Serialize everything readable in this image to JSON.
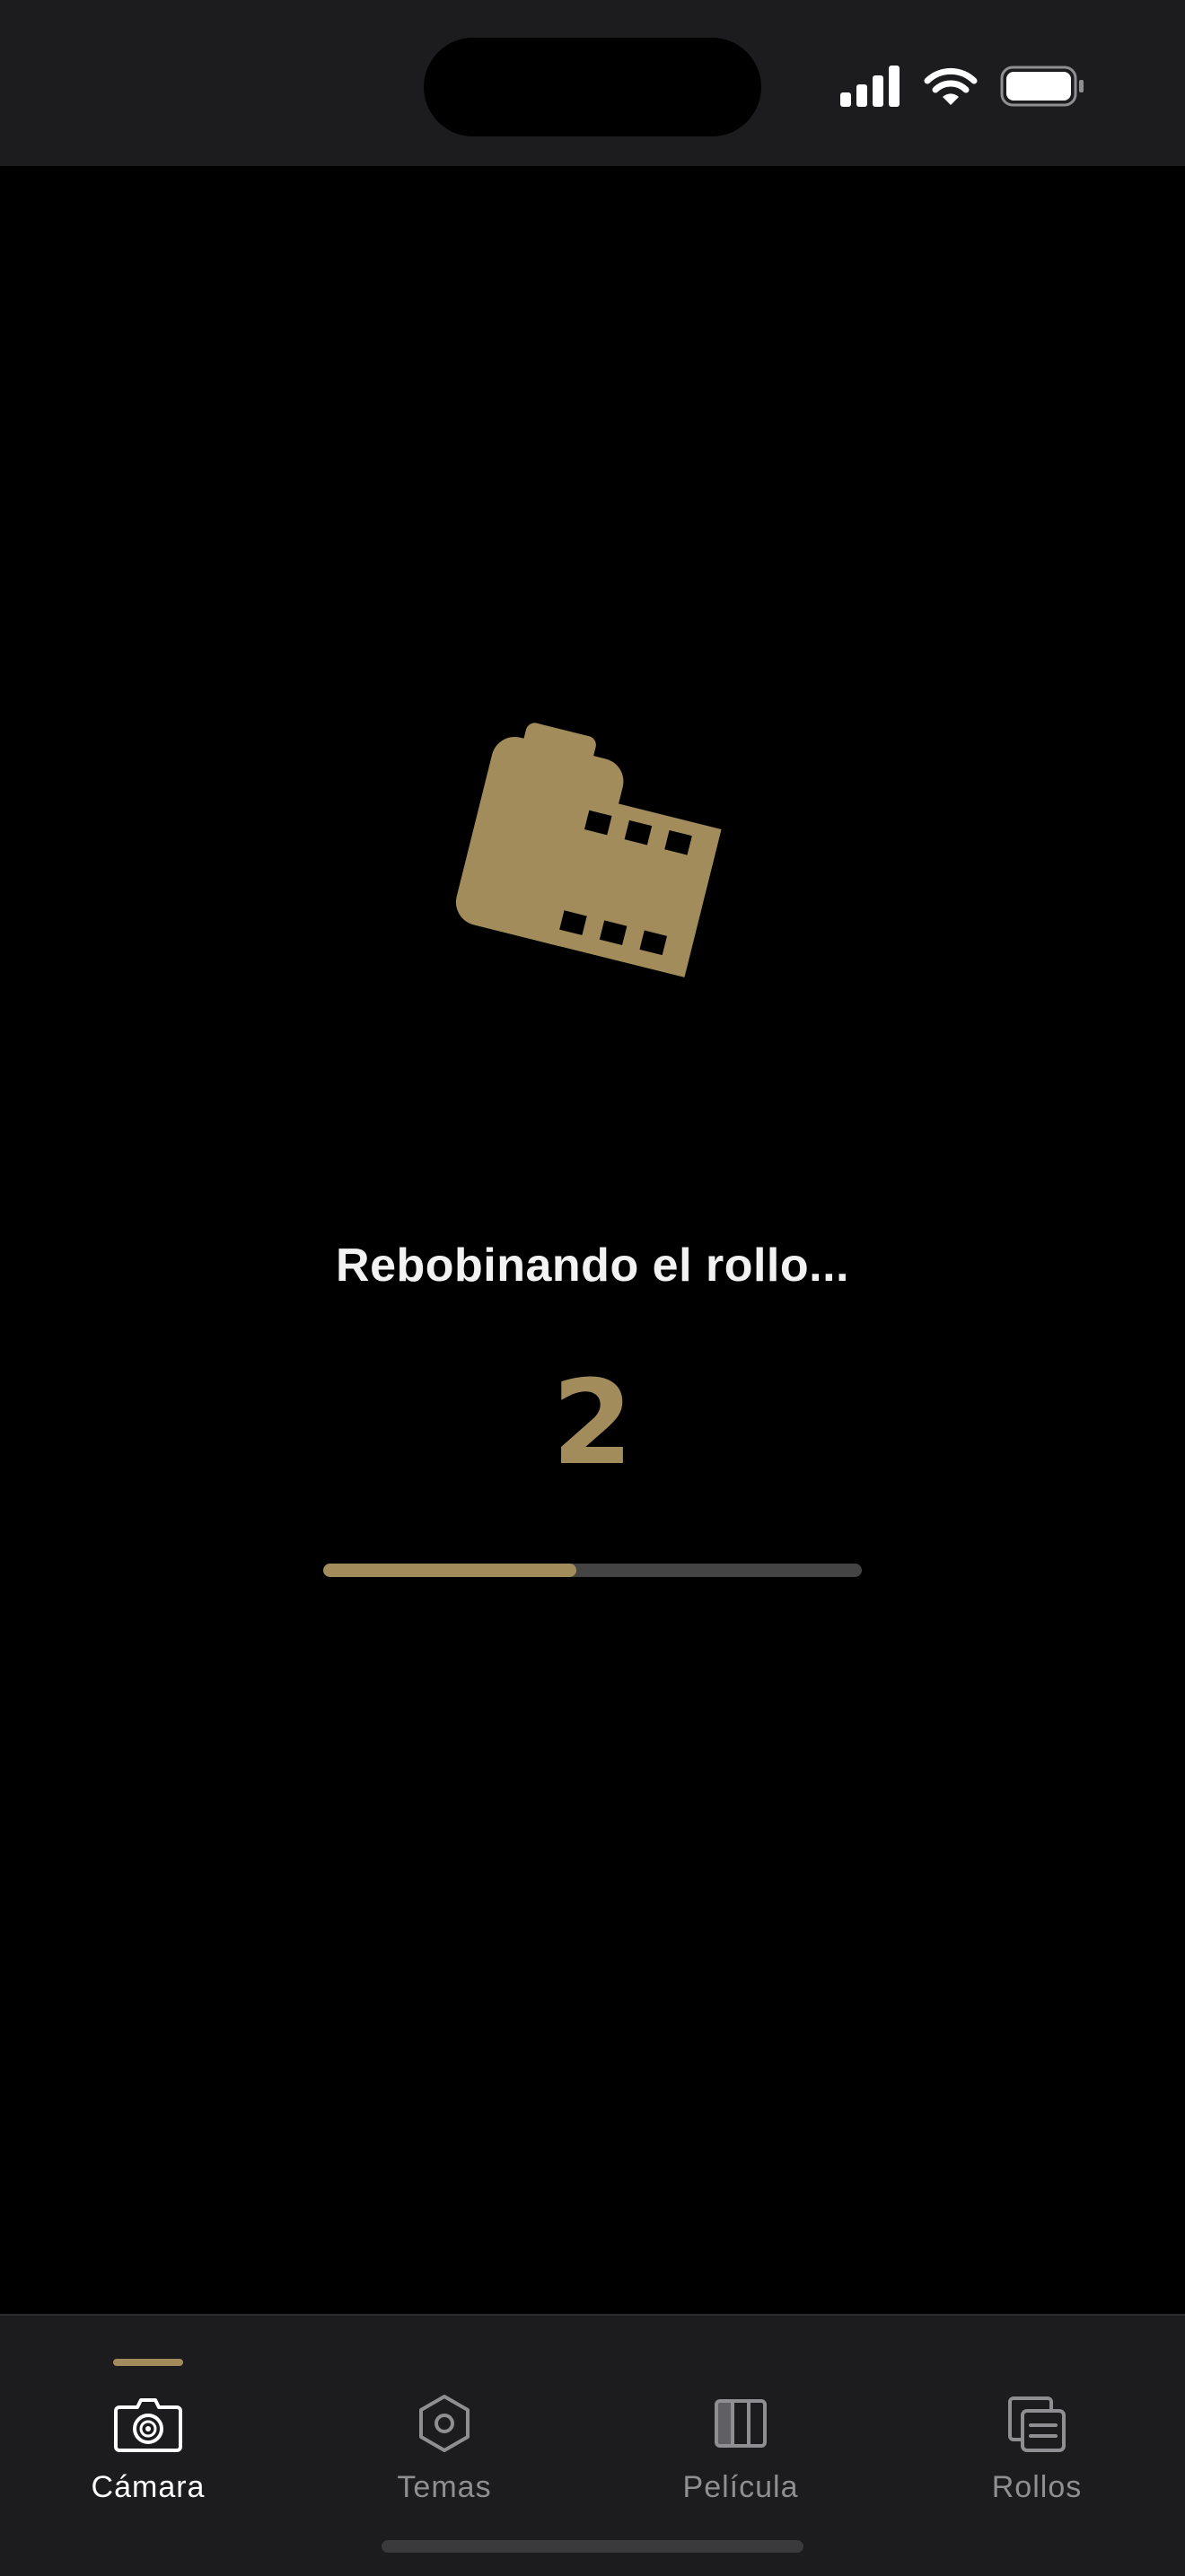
{
  "status_bar": {
    "icons": [
      "signal-icon",
      "wifi-icon",
      "battery-icon"
    ]
  },
  "main": {
    "icon": "film-canister-icon",
    "title": "Rebobinando el rollo...",
    "counter": "2",
    "progress": 0.47
  },
  "tabs": [
    {
      "label": "Cámara",
      "icon": "camera-icon",
      "active": true
    },
    {
      "label": "Temas",
      "icon": "hexagon-icon",
      "active": false
    },
    {
      "label": "Película",
      "icon": "film-icon",
      "active": false
    },
    {
      "label": "Rollos",
      "icon": "rolls-icon",
      "active": false
    }
  ],
  "colors": {
    "accent": "#a38c5c",
    "background": "#000000",
    "bar_background": "#1c1c1e",
    "inactive": "#8e8e93",
    "track": "#444444"
  }
}
